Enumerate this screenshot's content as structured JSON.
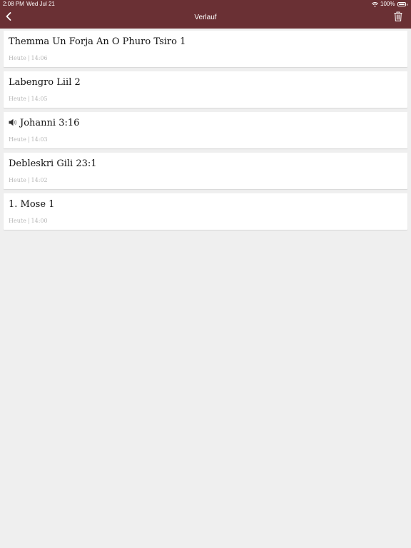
{
  "status_bar": {
    "time": "2:08 PM",
    "date": "Wed Jul 21",
    "battery": "100%",
    "battery_level": 1.0
  },
  "nav": {
    "title": "Verlauf",
    "back_icon": "chevron-left-icon",
    "trash_icon": "trash-icon"
  },
  "colors": {
    "header": "#6a3034",
    "background": "#efefef",
    "card": "#ffffff",
    "meta_text": "#b9b9b9"
  },
  "history": [
    {
      "title": "Themma Un Forja An O Phuro Tsiro 1",
      "day": "Heute",
      "time": "14:06",
      "audio": false
    },
    {
      "title": "Labengro Liil 2",
      "day": "Heute",
      "time": "14:05",
      "audio": false
    },
    {
      "title": "Johanni 3:16",
      "day": "Heute",
      "time": "14:03",
      "audio": true
    },
    {
      "title": "Debleskri Gili 23:1",
      "day": "Heute",
      "time": "14:02",
      "audio": false
    },
    {
      "title": "1. Mose 1",
      "day": "Heute",
      "time": "14:00",
      "audio": false
    }
  ],
  "meta_separator": "|"
}
